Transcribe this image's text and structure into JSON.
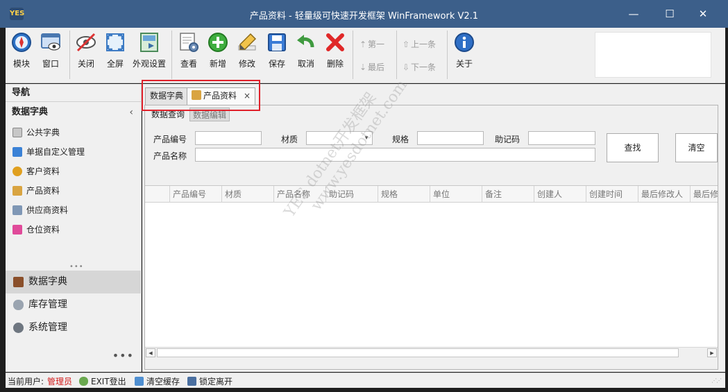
{
  "window": {
    "logo": "YES",
    "title": "产品资料 - 轻量级可快速开发框架 WinFramework V2.1",
    "controls": {
      "minimize": "—",
      "maximize": "☐",
      "close": "✕"
    }
  },
  "toolbar": {
    "buttons": [
      {
        "label": "模块",
        "icon": "compass-icon"
      },
      {
        "label": "窗口",
        "icon": "window-eye-icon"
      },
      {
        "label": "关闭",
        "icon": "eye-hide-icon"
      },
      {
        "label": "全屏",
        "icon": "fullscreen-icon"
      },
      {
        "label": "外观设置",
        "icon": "appearance-icon"
      },
      {
        "label": "查看",
        "icon": "view-gear-icon"
      },
      {
        "label": "新增",
        "icon": "add-icon"
      },
      {
        "label": "修改",
        "icon": "pencil-icon"
      },
      {
        "label": "保存",
        "icon": "floppy-icon"
      },
      {
        "label": "取消",
        "icon": "undo-icon"
      },
      {
        "label": "删除",
        "icon": "delete-x-icon"
      },
      {
        "label": "关于",
        "icon": "info-icon"
      }
    ],
    "nav": {
      "first": "第一",
      "last": "最后",
      "prev": "上一条",
      "next": "下一条"
    }
  },
  "sidebar": {
    "header": "导航",
    "group": "数据字典",
    "items": [
      "公共字典",
      "单据自定义管理",
      "客户资料",
      "产品资料",
      "供应商资料",
      "仓位资料"
    ],
    "sections": [
      "数据字典",
      "库存管理",
      "系统管理"
    ],
    "more": "•••"
  },
  "tabs": [
    {
      "label": "数据字典"
    },
    {
      "label": "产品资料",
      "close": "×"
    }
  ],
  "subtabs": [
    "数据查询",
    "数据编辑"
  ],
  "form": {
    "product_code": "产品编号",
    "material": "材质",
    "spec": "规格",
    "memo_code": "助记码",
    "product_name": "产品名称",
    "search_button": "查找",
    "clear_button": "清空"
  },
  "grid": {
    "columns": [
      "产品编号",
      "材质",
      "产品名称",
      "助记码",
      "规格",
      "单位",
      "备注",
      "创建人",
      "创建时间",
      "最后修改人",
      "最后修改"
    ]
  },
  "watermark": {
    "line1": "YES dotnet开发框架",
    "line2": "www.yesdotnet.com"
  },
  "statusbar": {
    "user_label": "当前用户:",
    "user_value": "管理员",
    "exit": "EXIT登出",
    "clear_cache": "清空缓存",
    "lock": "锁定离开"
  },
  "colors": {
    "titlebar": "#3c5f8a",
    "highlight": "#e0202a",
    "user": "#d21a1a"
  }
}
